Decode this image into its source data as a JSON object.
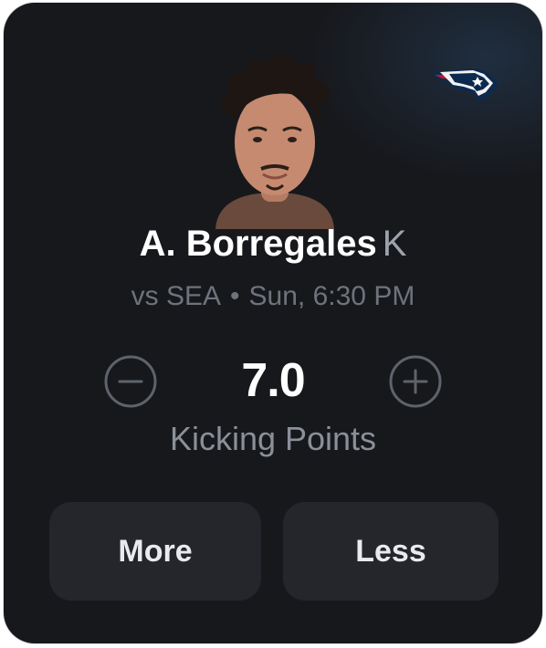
{
  "player": {
    "name": "A. Borregales",
    "position": "K"
  },
  "matchup": {
    "opponent": "vs SEA",
    "separator": "•",
    "time": "Sun, 6:30 PM"
  },
  "projection": {
    "value": "7.0",
    "stat": "Kicking Points"
  },
  "stepper": {
    "decrease_icon": "minus-circle-icon",
    "increase_icon": "plus-circle-icon"
  },
  "actions": {
    "more_label": "More",
    "less_label": "Less"
  },
  "team_logo": {
    "icon": "patriots-logo-icon"
  },
  "colors": {
    "card_background": "#17181c",
    "button_background": "#24262c",
    "primary_text": "#ffffff",
    "secondary_text": "#6e737c",
    "stat_label": "#8b9098",
    "logo_blue": "#0c2a4e",
    "logo_red": "#c8102e"
  }
}
